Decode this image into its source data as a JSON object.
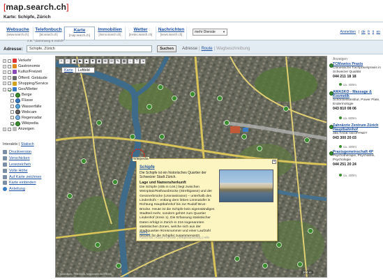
{
  "header": {
    "logo_open": "[",
    "logo_text": "map.search.ch",
    "logo_close": "]",
    "subtitle": "Karte: Schipfe, Zürich"
  },
  "tabs": [
    {
      "label": "Websuche",
      "sub": "[www.search.ch]"
    },
    {
      "label": "Telefonbuch",
      "sub": "[tel.search.ch]"
    },
    {
      "label": "Karte",
      "sub": "[map.search.ch]"
    },
    {
      "label": "Immobilien",
      "sub": "[immo.search.ch]"
    },
    {
      "label": "Wetter",
      "sub": "[meteo.search.ch]"
    },
    {
      "label": "Nachrichten",
      "sub": "[news.search.ch]"
    }
  ],
  "more_services": "mehr Dienste",
  "toplinks": [
    "Anmelden",
    "|",
    "de",
    "fr",
    "it",
    "en"
  ],
  "address": {
    "hint": "z.B. \"dammweg 5 zürich\"",
    "label": "Adresse:",
    "value": "Schipfe, Zürich",
    "button": "Suchen",
    "link1": "Adresse",
    "link2": "Route",
    "link3": "Wegbeschreibung"
  },
  "tree": [
    {
      "label": "Verkehr",
      "level": 0,
      "checked": false,
      "color": "#d33"
    },
    {
      "label": "Gastronomie",
      "level": 0,
      "checked": false,
      "color": "#e08a1e"
    },
    {
      "label": "Kultur/Freizeit",
      "level": 0,
      "checked": false,
      "color": "#8a49b5"
    },
    {
      "label": "Öffentl. Gebäude",
      "level": 0,
      "checked": false,
      "color": "#6a6a6a"
    },
    {
      "label": "Shopping/Service",
      "level": 0,
      "checked": false,
      "color": "#d1a31e"
    },
    {
      "label": "Geo/Wetter",
      "level": 0,
      "checked": true,
      "color": "#3a7cc4"
    },
    {
      "label": "Berge",
      "level": 1,
      "checked": false
    },
    {
      "label": "Flüsse",
      "level": 1,
      "checked": false
    },
    {
      "label": "Wasserfälle",
      "level": 1,
      "checked": false
    },
    {
      "label": "Webcam",
      "level": 1,
      "checked": false
    },
    {
      "label": "Regenradar",
      "level": 1,
      "checked": false
    },
    {
      "label": "Wikipedia",
      "level": 1,
      "checked": true
    },
    {
      "label": "Anzeigen",
      "level": 0,
      "checked": false,
      "color": "#bbb"
    }
  ],
  "interaktiv": {
    "label": "Interaktiv",
    "sep": "|",
    "statisch": "Statisch"
  },
  "side_links": [
    "Druckversion",
    "Verschicken",
    "Lesezeichen",
    "Volle Höhe",
    "Auf Karte zeichnen",
    "Karte einbinden",
    "Anleitung"
  ],
  "map": {
    "tab_active": "Karte",
    "tab_other": "Luftbild",
    "footer": "© search.ch, TeleAtlas, swisstopo dx/2/4040",
    "scale": "200 m",
    "controls": [
      "+",
      "−",
      "◀",
      "▶",
      "▲",
      "▼",
      "◉",
      "⊕",
      "⊖",
      "✎",
      "▦",
      "⌂",
      "?",
      "⇲"
    ]
  },
  "popup": {
    "tag": "Wikipedia",
    "title": "Schipfe",
    "intro": "Die Schipfe ist ein historisches Quartier der Schweizer Stadt Zürich.",
    "heading": "Lage und Namensherkunft",
    "body": "Die Schipfe (405 m ü.M.) liegt zwischen Weinplatz/Rathausbrücke (Strehlgasse) und der Gessnerbrücke (Uraniastrasse) – unterhalb des Lindenhofs – entlang dem linken Limmatufer in Richtung Hauptbahnhof bis zur Rudolf Brun-Brücke. Heute ist die Schipfe kein eigenständiges Stadtteil mehr, sondern gehört zum Quartier Lindenhof (Kreis 1). Die Erfassung statistischer Daten erfolgt in Zürich in 216 sogenannten statistischen Zonen, welche sich aus der Stadtquartier-/Kreisnummer und einer Laufzahl (D1301 für die Schipfe) zusammensetzt.",
    "more": "mehr...",
    "links": "Ausschnitt | Route | Adresse | Wikipedia-Eintrag | Hilfe"
  },
  "right": {
    "label": "Anzeigen",
    "ads": [
      {
        "title": "TCMswiss Praxis",
        "text": "Chinesische Fachpraxispraxis in Schweizer Qualität",
        "phone": "044 211 18 18",
        "dist": "ca. 400m"
      },
      {
        "title": "AMASKO - Massage & Kosmetik",
        "text": "Schönheitsinstitut, Power Plate, Endermologie",
        "phone": "043 810 08 06",
        "dist": "ca. 600m"
      },
      {
        "title": "Zahnärzte Zentrum Zürich Hauptbahnhof",
        "text": "365 TAGE GEÖFFNET",
        "phone": "043 300 20 03",
        "dist": "ca. 400m"
      },
      {
        "title": "Praxisgemeinschaft 4P",
        "text": "Psychotherapie, Psychiatrie, Psychologie",
        "phone": "044 251 20 24",
        "dist": "ca. 400m"
      }
    ]
  }
}
